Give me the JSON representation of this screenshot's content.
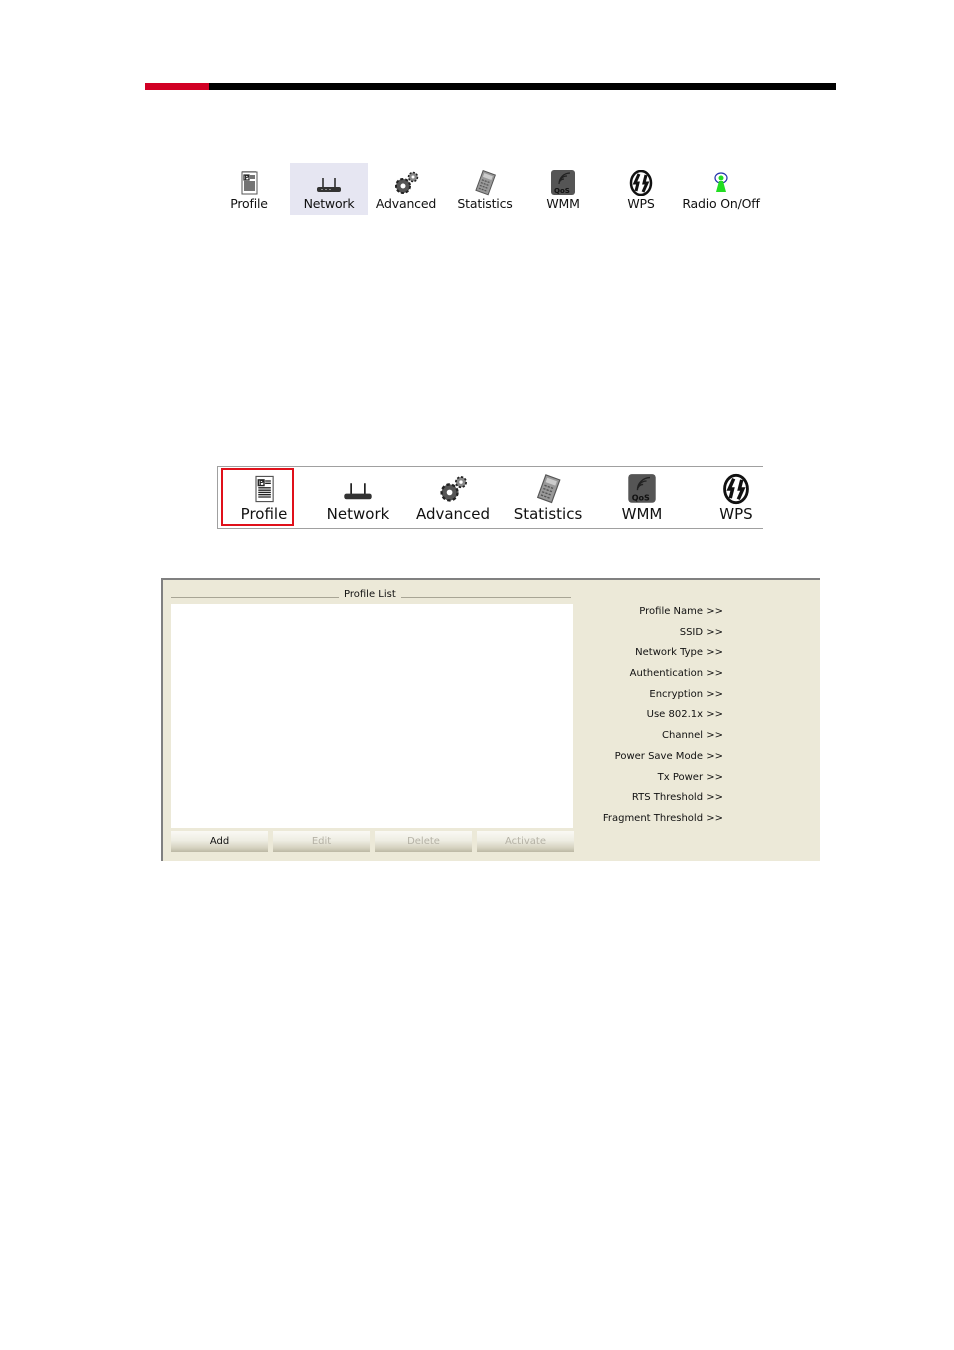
{
  "header": {
    "accent_color": "#d10024",
    "bar_color": "#000000"
  },
  "toolbar_full": {
    "items": [
      {
        "label": "Profile",
        "icon": "profile-icon",
        "active": false
      },
      {
        "label": "Network",
        "icon": "network-router-icon",
        "active": true
      },
      {
        "label": "Advanced",
        "icon": "gears-icon",
        "active": false
      },
      {
        "label": "Statistics",
        "icon": "calculator-icon",
        "active": false
      },
      {
        "label": "WMM",
        "icon": "qos-icon",
        "active": false
      },
      {
        "label": "WPS",
        "icon": "wps-icon",
        "active": false
      },
      {
        "label": "Radio On/Off",
        "icon": "radio-icon",
        "active": false
      }
    ],
    "active_bg": "#e6e6f2"
  },
  "toolbar_zoomed": {
    "items": [
      {
        "label": "Profile",
        "icon": "profile-icon",
        "selected": true
      },
      {
        "label": "Network",
        "icon": "network-router-icon"
      },
      {
        "label": "Advanced",
        "icon": "gears-icon"
      },
      {
        "label": "Statistics",
        "icon": "calculator-icon"
      },
      {
        "label": "WMM",
        "icon": "qos-icon"
      },
      {
        "label": "WPS",
        "icon": "wps-icon"
      }
    ],
    "highlight_color": "#e0101a"
  },
  "profile_panel": {
    "group_title": "Profile List",
    "buttons": [
      {
        "label": "Add",
        "enabled": true
      },
      {
        "label": "Edit",
        "enabled": false
      },
      {
        "label": "Delete",
        "enabled": false
      },
      {
        "label": "Activate",
        "enabled": false
      }
    ],
    "details": [
      "Profile Name >>",
      "SSID >>",
      "Network Type >>",
      "Authentication >>",
      "Encryption >>",
      "Use 802.1x >>",
      "Channel >>",
      "Power Save Mode >>",
      "Tx Power >>",
      "RTS Threshold >>",
      "Fragment Threshold >>"
    ],
    "panel_bg": "#ece9d8"
  }
}
